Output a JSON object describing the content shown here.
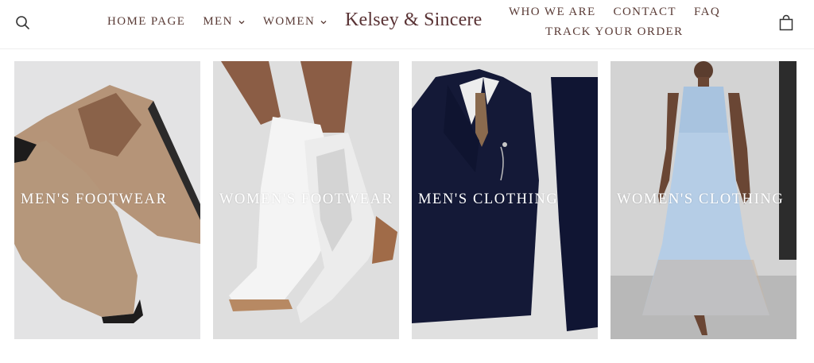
{
  "header": {
    "nav_left": [
      {
        "label": "HOME PAGE",
        "dropdown": false
      },
      {
        "label": "MEN",
        "dropdown": true
      },
      {
        "label": "WOMEN",
        "dropdown": true
      }
    ],
    "logo": "Kelsey & Sincere",
    "nav_right_top": [
      "WHO WE ARE",
      "CONTACT",
      "FAQ"
    ],
    "nav_right_bottom": "TRACK YOUR ORDER",
    "icons": {
      "search": "search-icon",
      "cart": "shopping-bag-icon"
    }
  },
  "tiles": [
    {
      "label": "MEN'S FOOTWEAR",
      "image": "tan suede chelsea boots"
    },
    {
      "label": "WOMEN'S FOOTWEAR",
      "image": "white perforated cowboy boots"
    },
    {
      "label": "MEN'S CLOTHING",
      "image": "navy three-piece suit"
    },
    {
      "label": "WOMEN'S CLOTHING",
      "image": "light blue floral maxi dress"
    }
  ],
  "colors": {
    "text": "#5a3b36",
    "label": "#ffffff"
  }
}
